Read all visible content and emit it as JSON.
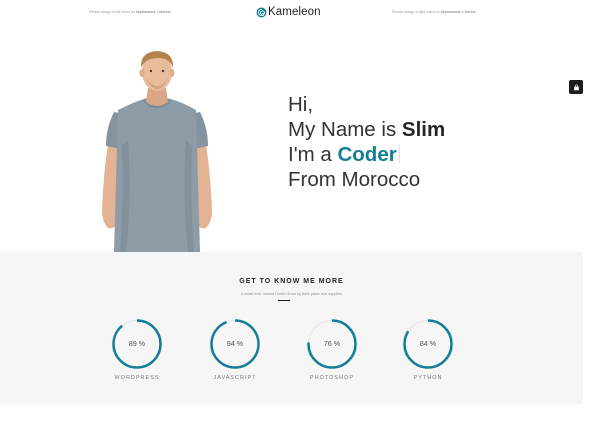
{
  "header": {
    "left_note": {
      "text": "Please assign a left menu on ",
      "emphasis": "Appearance > Menus"
    },
    "right_note": {
      "text": "Please assign a right menu on ",
      "emphasis": "Appearance > Menus"
    },
    "logo_text": "Kameleon",
    "logo_icon": "spiral-logo-icon"
  },
  "cart": {
    "icon": "shopping-bag-icon"
  },
  "hero": {
    "greeting": "Hi,",
    "name_prefix": "My Name is ",
    "name": "Slim",
    "role_prefix": "I'm a ",
    "role": "Coder",
    "location": "From Morocco",
    "photo": "man-in-grey-tshirt-photo"
  },
  "skills": {
    "title": "GET TO KNOW ME MORE",
    "subtitle": "A small river named Duden flows by their place and supplies",
    "items": [
      {
        "name": "WORDPRESS",
        "value": 89,
        "display": "89 %"
      },
      {
        "name": "JAVASCRIPT",
        "value": 94,
        "display": "94 %"
      },
      {
        "name": "PHOTOSHOP",
        "value": 76,
        "display": "76 %"
      },
      {
        "name": "PYTHON",
        "value": 84,
        "display": "84 %"
      }
    ]
  },
  "colors": {
    "accent": "#147e96",
    "ring_track": "#e6e6e6",
    "cart_bg": "#1e1e1e",
    "skills_bg": "#f6f6f6"
  }
}
